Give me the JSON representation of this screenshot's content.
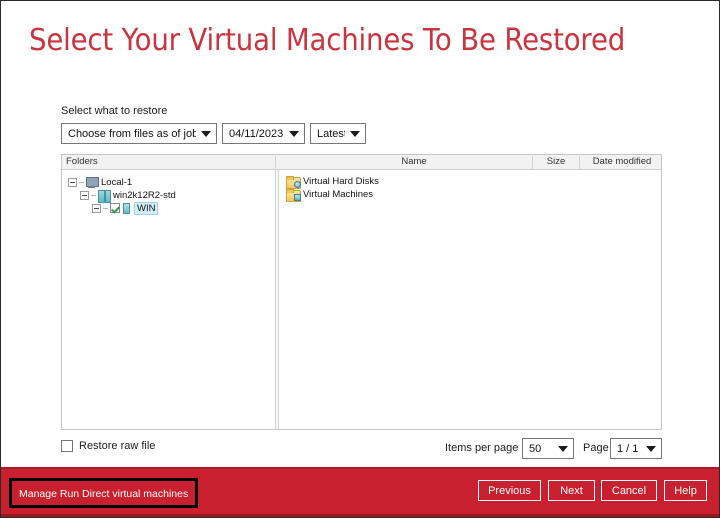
{
  "page": {
    "title": "Select Your Virtual Machines To Be Restored",
    "accent_color": "#c8353f",
    "footer_color": "#c8202e"
  },
  "form": {
    "label": "Select what to restore",
    "source_select": {
      "value": "Choose from files as of job",
      "icon": "chevron-down-icon"
    },
    "date_select": {
      "value": "04/11/2023",
      "icon": "chevron-down-icon"
    },
    "time_select": {
      "value": "Latest",
      "icon": "chevron-down-icon"
    }
  },
  "explorer": {
    "columns": [
      {
        "key": "folders",
        "label": "Folders"
      },
      {
        "key": "name",
        "label": "Name"
      },
      {
        "key": "size",
        "label": "Size"
      },
      {
        "key": "date",
        "label": "Date modified"
      }
    ],
    "tree": [
      {
        "label": "Local-1",
        "icon": "computer-icon",
        "expanded": true,
        "checkbox": false,
        "selected": false
      },
      {
        "label": "win2k12R2-std",
        "icon": "server-icon",
        "expanded": true,
        "checkbox": false,
        "selected": false
      },
      {
        "label": "WIN",
        "icon": "vm-icon",
        "expanded": true,
        "checkbox": true,
        "checked": true,
        "selected": true
      }
    ],
    "files": [
      {
        "name": "Virtual Hard Disks",
        "size": "",
        "date_modified": "",
        "icon": "folder-virtual-hard-disks-icon"
      },
      {
        "name": "Virtual Machines",
        "size": "",
        "date_modified": "",
        "icon": "folder-virtual-machines-icon"
      }
    ]
  },
  "bottom": {
    "restore_raw_label": "Restore raw file",
    "restore_raw_checked": false,
    "items_per_page_label": "Items per page",
    "items_per_page_value": "50",
    "page_label": "Page",
    "page_value": "1 / 1"
  },
  "footer": {
    "manage_link": "Manage Run Direct virtual machines",
    "buttons": [
      {
        "id": "previous",
        "label": "Previous"
      },
      {
        "id": "next",
        "label": "Next"
      },
      {
        "id": "cancel",
        "label": "Cancel"
      },
      {
        "id": "help",
        "label": "Help"
      }
    ]
  }
}
